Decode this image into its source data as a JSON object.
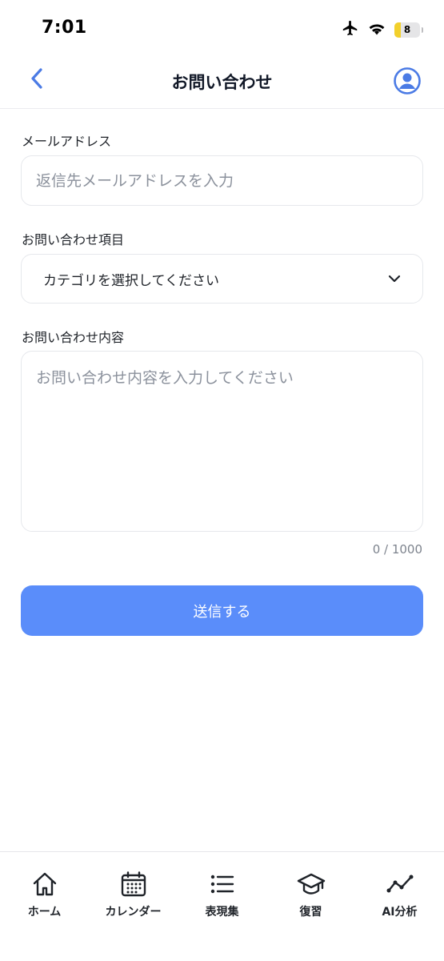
{
  "status_bar": {
    "time": "7:01",
    "battery": "8"
  },
  "header": {
    "title": "お問い合わせ",
    "accent_color": "#4b7be5"
  },
  "form": {
    "email": {
      "label": "メールアドレス",
      "placeholder": "返信先メールアドレスを入力",
      "value": ""
    },
    "category": {
      "label": "お問い合わせ項目",
      "selected": "カテゴリを選択してください"
    },
    "message": {
      "label": "お問い合わせ内容",
      "placeholder": "お問い合わせ内容を入力してください",
      "value": "",
      "counter": "0 / 1000"
    },
    "submit_label": "送信する",
    "submit_color": "#5a8dfa"
  },
  "tab_bar": {
    "items": [
      {
        "label": "ホーム",
        "icon": "home-icon"
      },
      {
        "label": "カレンダー",
        "icon": "calendar-icon"
      },
      {
        "label": "表現集",
        "icon": "list-icon"
      },
      {
        "label": "復習",
        "icon": "graduation-cap-icon"
      },
      {
        "label": "AI分析",
        "icon": "trend-line-icon"
      }
    ]
  }
}
